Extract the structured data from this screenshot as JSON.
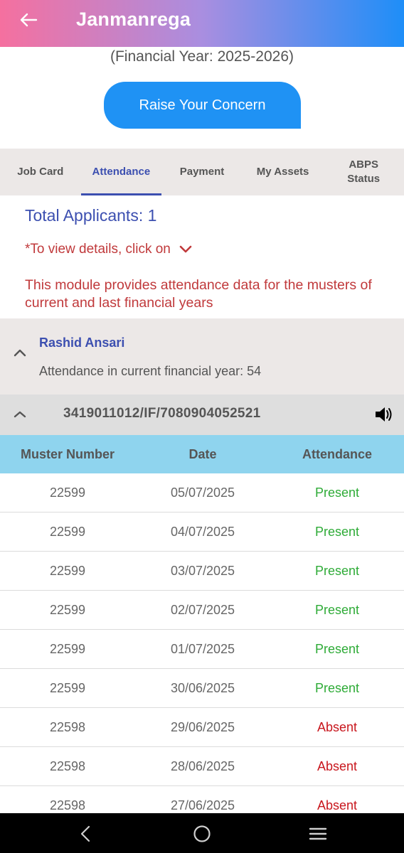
{
  "app_bar": {
    "title": "Janmanrega",
    "back_icon": "back-arrow-icon"
  },
  "financial_year": "(Financial Year: 2025-2026)",
  "concern_button": "Raise Your Concern",
  "tabs": [
    {
      "label": "Job Card",
      "active": false
    },
    {
      "label": "Attendance",
      "active": true
    },
    {
      "label": "Payment",
      "active": false
    },
    {
      "label": "My Assets",
      "active": false
    },
    {
      "label": "ABPS Status",
      "active": false
    }
  ],
  "summary": {
    "total_applicants": "Total Applicants: 1",
    "hint": "*To view details, click on",
    "module_note": "This module provides attendance data for the musters of current and last financial years"
  },
  "applicant": {
    "name": "Rashid Ansari",
    "attendance_line": "Attendance in current financial year: 54"
  },
  "job_card": {
    "id": "3419011012/IF/7080904052521"
  },
  "table": {
    "headers": [
      "Muster Number",
      "Date",
      "Attendance"
    ],
    "rows": [
      {
        "muster": "22599",
        "date": "05/07/2025",
        "status": "Present"
      },
      {
        "muster": "22599",
        "date": "04/07/2025",
        "status": "Present"
      },
      {
        "muster": "22599",
        "date": "03/07/2025",
        "status": "Present"
      },
      {
        "muster": "22599",
        "date": "02/07/2025",
        "status": "Present"
      },
      {
        "muster": "22599",
        "date": "01/07/2025",
        "status": "Present"
      },
      {
        "muster": "22599",
        "date": "30/06/2025",
        "status": "Present"
      },
      {
        "muster": "22598",
        "date": "29/06/2025",
        "status": "Absent"
      },
      {
        "muster": "22598",
        "date": "28/06/2025",
        "status": "Absent"
      },
      {
        "muster": "22598",
        "date": "27/06/2025",
        "status": "Absent"
      }
    ]
  },
  "colors": {
    "gradient_start": "#f5709f",
    "gradient_end": "#1e8ef8",
    "accent_blue": "#3c4fb0",
    "present_green": "#2eab37",
    "absent_red": "#c8161d",
    "header_cyan": "#8fd4ee"
  },
  "system_nav": {
    "icons": [
      "nav-back-icon",
      "nav-home-icon",
      "nav-recents-icon"
    ]
  }
}
